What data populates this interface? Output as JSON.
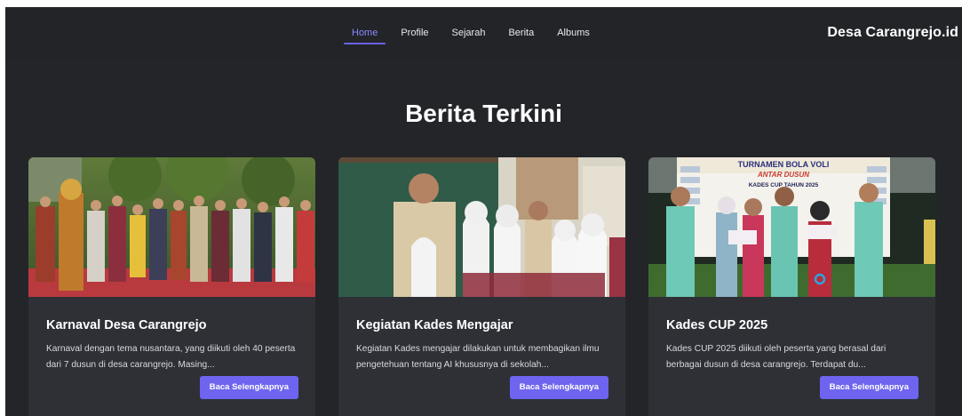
{
  "nav": {
    "links": [
      "Home",
      "Profile",
      "Sejarah",
      "Berita",
      "Albums"
    ],
    "active": "Home",
    "brand": "Desa Carangrejo.id"
  },
  "section": {
    "title": "Berita Terkini"
  },
  "cards": [
    {
      "title": "Karnaval Desa Carangrejo",
      "excerpt": "Karnaval dengan tema nusantara, yang diikuti oleh 40 peserta dari 7 dusun di desa carangrejo. Masing...",
      "button": "Baca Selengkapnya"
    },
    {
      "title": "Kegiatan Kades Mengajar",
      "excerpt": "Kegiatan Kades mengajar dilakukan untuk membagikan ilmu pengetehuan tentang AI khususnya di sekolah...",
      "button": "Baca Selengkapnya"
    },
    {
      "title": "Kades CUP 2025",
      "excerpt": "Kades CUP 2025 diikuti oleh peserta yang berasal dari berbagai dusun di desa carangrejo. Terdapat du...",
      "button": "Baca Selengkapnya",
      "banner_lines": [
        "TURNAMEN BOLA VOLI",
        "ANTAR DUSUN",
        "KADES CUP TAHUN 2025"
      ]
    }
  ],
  "colors": {
    "background": "#232529",
    "card": "#2e3036",
    "accent": "#6e64ef",
    "active_link": "#8b87ff"
  }
}
